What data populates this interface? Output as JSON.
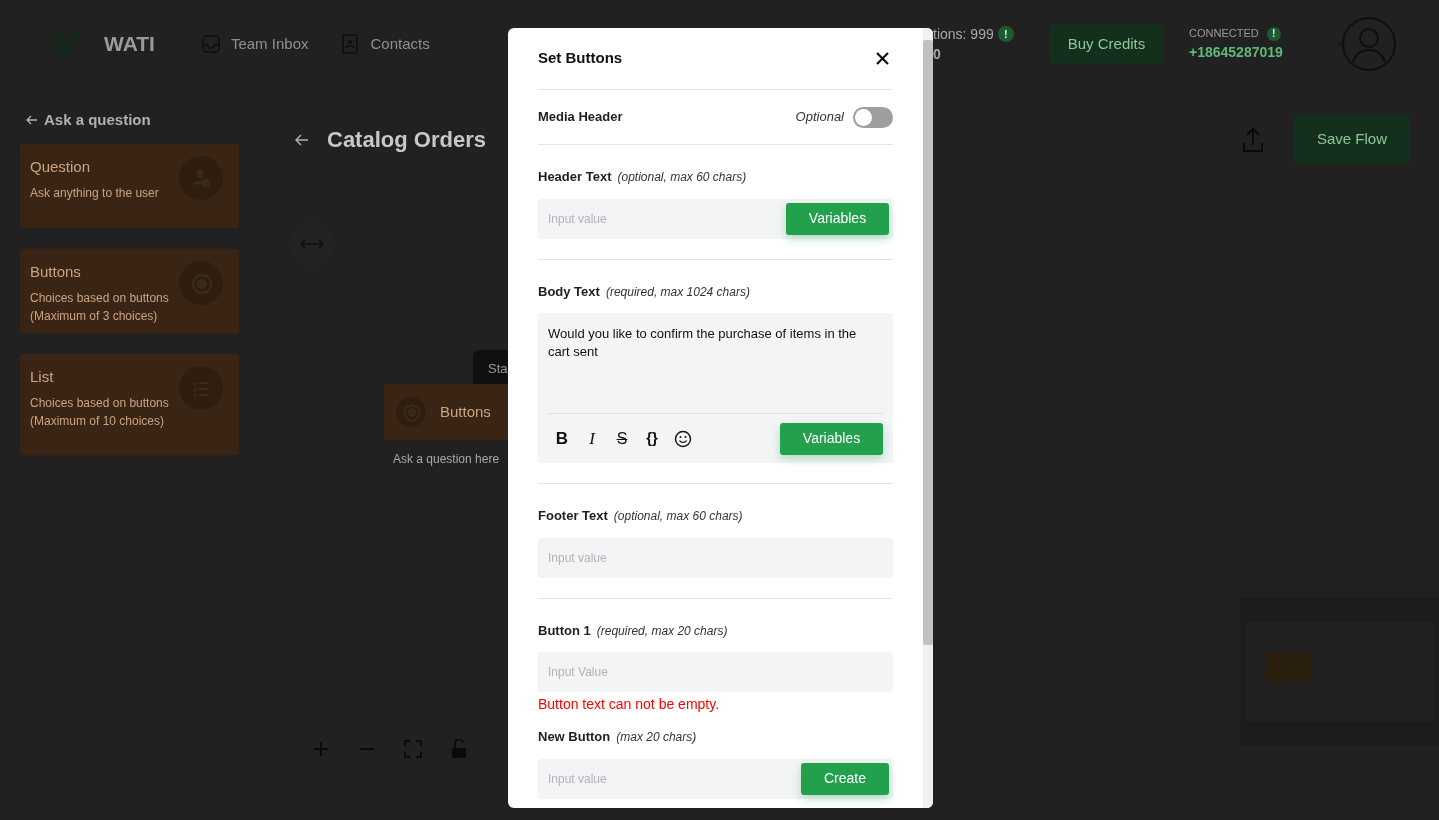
{
  "topbar": {
    "brand": "WATI",
    "nav": [
      {
        "label": "Team Inbox",
        "kind": "inbox"
      },
      {
        "label": "Contacts",
        "kind": "contacts"
      }
    ],
    "notifications": {
      "label": "tions: 999",
      "badge": "!",
      "second_line": "0"
    },
    "buy_credits": "Buy Credits",
    "connection": {
      "status": "CONNECTED",
      "badge": "!",
      "phone": "+18645287019"
    }
  },
  "sidebar": {
    "back_label": "Ask a question",
    "cards": [
      {
        "title": "Question",
        "description": "Ask anything to the user",
        "kind": "question"
      },
      {
        "title": "Buttons",
        "description": "Choices based on buttons (Maximum of 3 choices)",
        "kind": "buttons"
      },
      {
        "title": "List",
        "description": "Choices based on buttons (Maximum of 10 choices)",
        "kind": "list"
      }
    ]
  },
  "canvas": {
    "flow_title": "Catalog Orders",
    "save_button": "Save Flow",
    "start_tag": "Sta",
    "node": {
      "title": "Buttons",
      "caption": "Ask a question here"
    }
  },
  "modal": {
    "title": "Set Buttons",
    "media_header": {
      "label": "Media Header",
      "optional_label": "Optional",
      "on": false
    },
    "fields": [
      {
        "kind": "input",
        "label": "Header Text",
        "hint": "(optional, max 60 chars)",
        "placeholder": "Input value",
        "button": "Variables"
      },
      {
        "kind": "editor",
        "label": "Body Text",
        "hint": "(required, max 1024 chars)",
        "value": "Would you like to confirm the purchase of items in the cart sent",
        "toolbar": [
          {
            "kind": "bold",
            "glyph": "B"
          },
          {
            "kind": "italic",
            "glyph": "I"
          },
          {
            "kind": "strike",
            "glyph": "S"
          },
          {
            "kind": "code",
            "glyph": "{}"
          }
        ],
        "button": "Variables"
      },
      {
        "kind": "input",
        "label": "Footer Text",
        "hint": "(optional, max 60 chars)",
        "placeholder": "Input value"
      },
      {
        "kind": "input",
        "label": "Button 1",
        "hint": "(required, max 20 chars)",
        "placeholder": "Input Value",
        "error": "Button text can not be empty."
      },
      {
        "kind": "input",
        "label": "New Button",
        "hint": "(max 20 chars)",
        "placeholder": "Input value",
        "button": "Create"
      }
    ]
  }
}
